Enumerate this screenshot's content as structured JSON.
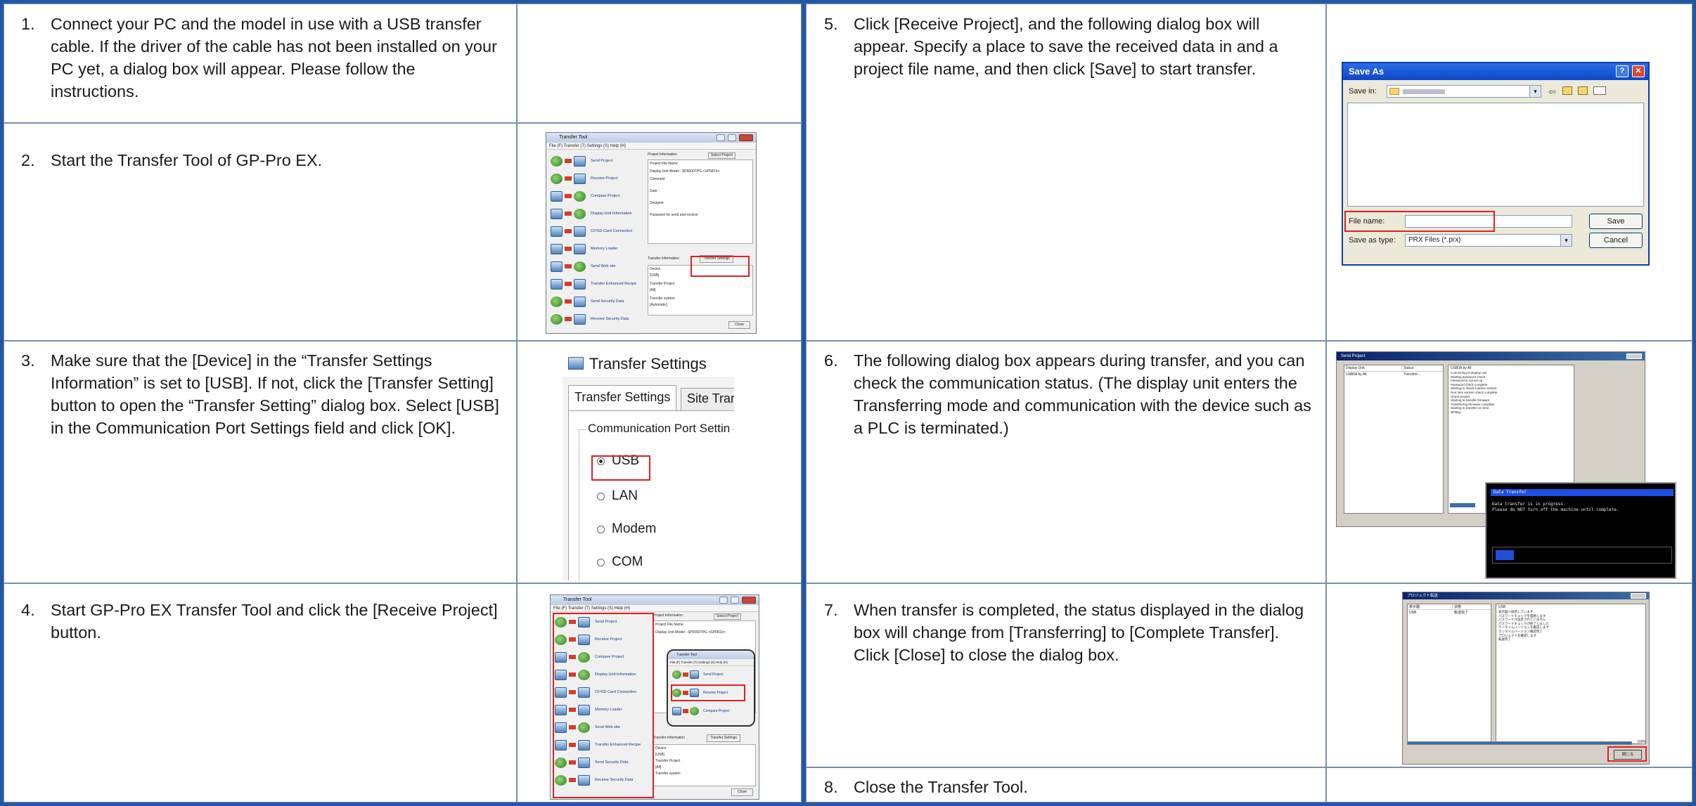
{
  "steps": {
    "s1": {
      "num": "1.",
      "text": "Connect your PC and the model in use with a USB transfer cable. If the driver of the cable has not been installed on your PC yet, a dialog box will appear. Please follow the instructions."
    },
    "s2": {
      "num": "2.",
      "text": "Start the Transfer Tool of GP-Pro EX."
    },
    "s3": {
      "num": "3.",
      "text": "Make sure that the [Device] in the “Transfer Settings Information” is set to [USB]. If not, click the [Transfer Setting] button to open the “Transfer Setting” dialog box. Select [USB] in the Communication Port Settings field and click [OK]."
    },
    "s4": {
      "num": "4.",
      "text": "Start GP-Pro EX Transfer Tool and click the [Receive Project] button."
    },
    "s5": {
      "num": "5.",
      "text": "Click [Receive Project], and the following dialog box will appear. Specify a place to save the received data in and a project file name, and then click [Save] to start transfer."
    },
    "s6": {
      "num": "6.",
      "text": "The following dialog box appears during transfer, and you can check the communication status. (The display unit enters the Transferring mode and communication with the device such as a PLC is terminated.)"
    },
    "s7": {
      "num": "7.",
      "text": "When transfer is completed, the status displayed in the dialog box will change from [Transferring] to [Complete Transfer]. Click [Close] to close the dialog box."
    },
    "s8": {
      "num": "8.",
      "text": "Close the Transfer Tool."
    }
  },
  "transfer_tool": {
    "title": "Transfer Tool",
    "menu": "File (F)   Transfer (T)   Settings (S)   Help (H)",
    "buttons": [
      "Send Project",
      "Receive Project",
      "Compare Project",
      "Display Unit Information",
      "CF/SD Card Connection",
      "Memory Loader",
      "Send Web site",
      "Transfer Enhanced Recipe",
      "Send Security Data",
      "Receive Security Data"
    ],
    "project_info": "Project Information",
    "select_project": "Select Project",
    "project_file_name": "Project File Name",
    "display_unit_model": "Display Unit Model : SP5000TPG <SP5B10>",
    "comment": "Comment",
    "date": "Date",
    "designer": "Designer",
    "password": "Password for send and receive",
    "transfer_info": "Transfer Information",
    "transfer_settings_btn": "Transfer Settings",
    "device": "Device",
    "device_val": "[USB]",
    "transfer_project": "Transfer Project",
    "transfer_project_val": "[All]",
    "transfer_system": "Transfer system",
    "transfer_system_val": "[Automatic]",
    "close": "Close"
  },
  "transfer_settings": {
    "title": "Transfer Settings",
    "tab1": "Transfer Settings",
    "tab2": "Site Tran",
    "group": "Communication Port Settin",
    "options": [
      "USB",
      "LAN",
      "Modem",
      "COM"
    ]
  },
  "save_as": {
    "title": "Save As",
    "save_in_label": "Save in:",
    "file_name_label": "File name:",
    "save_as_type_label": "Save as type:",
    "save_as_type_value": "PRX Files (*.prx)",
    "save_btn": "Save",
    "cancel_btn": "Cancel"
  },
  "send_project": {
    "title": "Send Project",
    "col_unit": "Display Unit",
    "col_status": "Status",
    "col_log": "USB0A by All",
    "row_unit": "USB0A by All",
    "row_status": "Transferr...",
    "log": [
      "Connecting to display unit",
      "Starting password check",
      "Password is not set up",
      "Password check complete",
      "Starting to check runtime version",
      "Run time version check complete",
      "Check project",
      "Starting to transfer firmware",
      "Transferring firmware complete",
      "Starting to transfer run time",
      "Writing..."
    ]
  },
  "data_transfer": {
    "title": "Data Transfer",
    "line1": "Data transfer is in progress.",
    "line2": "Please do NOT turn off the machine until complete."
  },
  "complete_dialog": {
    "title": "プロジェクト転送",
    "col_unit": "表示器",
    "col_status": "状態",
    "col_log": "USB",
    "row_unit": "USB",
    "row_status": "転送完了",
    "log": [
      "表示器へ接続しています",
      "パスワードチェックを開始します",
      "パスワードが設定されていません",
      "パスワードチェックが終了しました",
      "ランタイムバージョンを確認します",
      "ランタイムバージョン確認完了",
      "プロジェクトを確認します",
      "転送完了"
    ],
    "percent": "100%",
    "close_btn": "閉じる"
  }
}
